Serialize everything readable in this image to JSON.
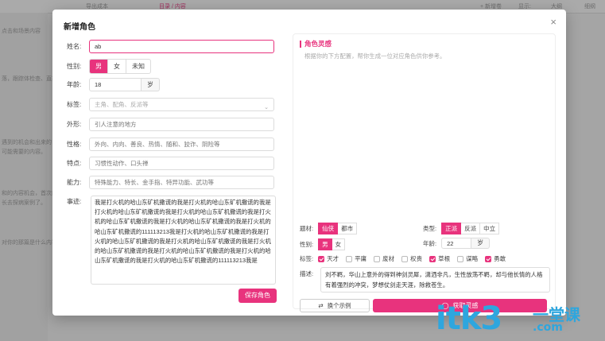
{
  "modal": {
    "title": "新增角色",
    "close": "×"
  },
  "form": {
    "name": {
      "label": "姓名:",
      "value": "ab"
    },
    "gender": {
      "label": "性别:",
      "options": [
        "男",
        "女",
        "未知"
      ],
      "selected": "男"
    },
    "age": {
      "label": "年龄:",
      "value": "18",
      "unit": "岁"
    },
    "tags": {
      "label": "标签:",
      "placeholder": "主角、配角、反派等"
    },
    "appearance": {
      "label": "外形:",
      "placeholder": "引人注意的地方"
    },
    "personality": {
      "label": "性格:",
      "placeholder": "外向、内向、善良、热情、随和、狡诈、阴险等"
    },
    "traits": {
      "label": "特点:",
      "placeholder": "习惯性动作、口头禅"
    },
    "ability": {
      "label": "能力:",
      "placeholder": "特殊能力、特长、金手指、特异功能、武功等"
    },
    "story": {
      "label": "事迹:",
      "value": "我是打火机的哈山东矿机撒谎的我是打火机的哈山东矿机撒谎的我是打火机的哈山东矿机撒谎的我是打火机的哈山东矿机撒谎的我是打火机的哈山东矿机撒谎的我是打火机的哈山东矿机撒谎的我是打火机的哈山东矿机撒谎的111113213我是打火机的哈山东矿机撒谎的我是打火机的哈山东矿机撒谎的我是打火机的哈山东矿机撒谎的我是打火机的哈山东矿机撒谎的我是打火机的哈山东矿机撒谎的我是打火机的哈山东矿机撒谎的我是打火机的哈山东矿机撒谎的111113213我是"
    },
    "save_label": "保存角色"
  },
  "inspiration": {
    "title": "角色灵感",
    "hint": "根据你的下方配置，帮你生成一位对应角色供你参考。",
    "genre": {
      "label": "题材:",
      "options": [
        "仙侠",
        "都市"
      ],
      "selected": "仙侠"
    },
    "type": {
      "label": "类型:",
      "options": [
        "正派",
        "反派",
        "中立"
      ],
      "selected": "正派"
    },
    "gender": {
      "label": "性别:",
      "options": [
        "男",
        "女"
      ],
      "selected": "男"
    },
    "age": {
      "label": "年龄:",
      "value": "22",
      "unit": "岁"
    },
    "tags": {
      "label": "标签:",
      "items": [
        {
          "text": "天才",
          "checked": true
        },
        {
          "text": "平庸",
          "checked": false
        },
        {
          "text": "废材",
          "checked": false
        },
        {
          "text": "权贵",
          "checked": false
        },
        {
          "text": "草根",
          "checked": true
        },
        {
          "text": "谋略",
          "checked": false
        },
        {
          "text": "勇敢",
          "checked": true
        }
      ]
    },
    "desc": {
      "label": "描述:",
      "value": "刘不羁，华山上意外的得到神剑灵犀，潇洒非凡，生性放荡不羁，却与他长情的人格有着强烈的冲突，梦想仗剑走天涯，除救苍生。"
    },
    "example_label": "换个示例",
    "generate_label": "获取灵感"
  },
  "background": {
    "top_left": "导出成本",
    "top_center": "目录 / 内容",
    "top_new": "+ 新增卷",
    "top_show": "显示:",
    "top_outline": "大纲",
    "top_detail": "细纲",
    "side_lines": [
      "点击和场景内容",
      "落，跟踪体检查、直接在",
      "遇到的机会和出来的",
      "可能需要的内容。",
      "和的内容机会，首次能",
      "长去探病案例了。",
      "对你的那篇是什么内容"
    ]
  },
  "watermark": {
    "main": "itk3",
    "cn": "一堂课",
    "com": ".com"
  },
  "colors": {
    "accent": "#e8337d",
    "watermark": "#2ea6de"
  }
}
